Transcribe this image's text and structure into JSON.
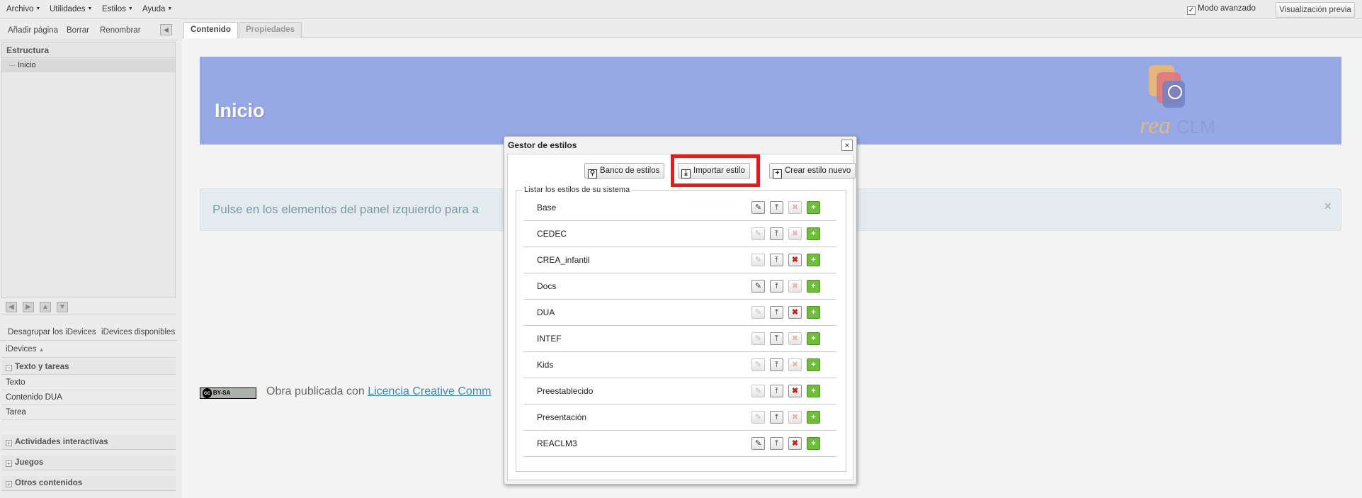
{
  "menubar": {
    "items": [
      "Archivo",
      "Utilidades",
      "Estilos",
      "Ayuda"
    ],
    "advanced_mode_label": "Modo avanzado",
    "advanced_mode_checked": true,
    "preview_label": "Visualización previa"
  },
  "left_panel": {
    "toolbar": {
      "add_page": "Añadir página",
      "delete": "Borrar",
      "rename": "Renombrar"
    },
    "structure_title": "Estructura",
    "structure_nodes": [
      "Inicio"
    ],
    "idevice_tabs": {
      "ungroup": "Desagrupar los iDevices",
      "available": "iDevices disponibles"
    },
    "idevices_header": "iDevices",
    "categories": {
      "text_tasks": {
        "label": "Texto y tareas",
        "items": [
          "Texto",
          "Contenido DUA",
          "Tarea"
        ]
      },
      "interactive": {
        "label": "Actividades interactivas"
      },
      "games": {
        "label": "Juegos"
      },
      "other": {
        "label": "Otros contenidos"
      }
    }
  },
  "main": {
    "tabs": {
      "content": "Contenido",
      "properties": "Propiedades"
    },
    "page_title": "Inicio",
    "logo_text_a": "rea",
    "logo_text_b": "CLM",
    "alert_text": "Pulse en los elementos del panel izquierdo para a",
    "alert_close": "×",
    "license_badge": "BY-SA",
    "footer_text": "Obra publicada con ",
    "footer_link": "Licencia Creative Comm"
  },
  "colors": {
    "banner": "#97a8e6",
    "highlight": "#e21b1b",
    "add_green": "#6cbf36"
  },
  "modal": {
    "title": "Gestor de estilos",
    "close_label": "×",
    "buttons": {
      "bank": "Banco de estilos",
      "import": "Importar estilo",
      "create": "Crear estilo nuevo"
    },
    "fieldset_legend": "Listar los estilos de su sistema",
    "styles": [
      {
        "name": "Base",
        "edit_enabled": true,
        "delete_enabled": false
      },
      {
        "name": "CEDEC",
        "edit_enabled": false,
        "delete_enabled": false
      },
      {
        "name": "CREA_infantil",
        "edit_enabled": false,
        "delete_enabled": true
      },
      {
        "name": "Docs",
        "edit_enabled": true,
        "delete_enabled": false
      },
      {
        "name": "DUA",
        "edit_enabled": false,
        "delete_enabled": true
      },
      {
        "name": "INTEF",
        "edit_enabled": false,
        "delete_enabled": false
      },
      {
        "name": "Kids",
        "edit_enabled": false,
        "delete_enabled": false
      },
      {
        "name": "Preestablecido",
        "edit_enabled": false,
        "delete_enabled": true
      },
      {
        "name": "Presentación",
        "edit_enabled": false,
        "delete_enabled": false
      },
      {
        "name": "REACLM3",
        "edit_enabled": true,
        "delete_enabled": true
      }
    ]
  }
}
